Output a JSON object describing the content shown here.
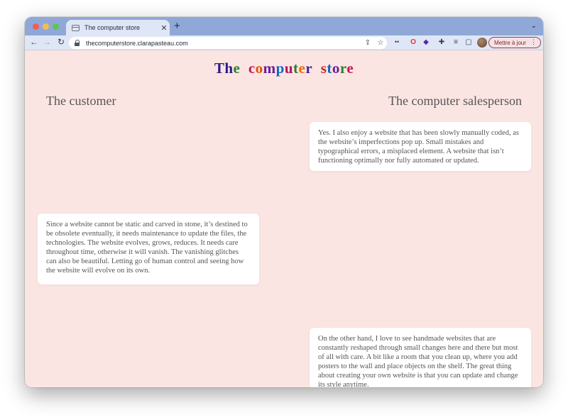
{
  "browser": {
    "tab_title": "The computer store",
    "url": "thecomputerstore.clarapasteau.com",
    "update_button": "Mettre à jour",
    "icons": [
      "back-icon",
      "forward-icon",
      "reload-icon",
      "lock-icon",
      "share-icon",
      "star-icon",
      "opera-icon",
      "extensions-icon",
      "reading-list-icon",
      "side-panel-icon",
      "avatar",
      "menu-icon"
    ]
  },
  "page": {
    "title_words": [
      {
        "text": "The",
        "color": "#1a1a7a"
      },
      {
        "text": "computer",
        "color": "#c02a9a"
      },
      {
        "text": "store",
        "color": "#6a2a9a"
      }
    ],
    "title_letters": [
      {
        "ch": "T",
        "color": "#2a1a8a"
      },
      {
        "ch": "h",
        "color": "#2a1a8a"
      },
      {
        "ch": "e",
        "color": "#2e7d32"
      },
      {
        "ch": " ",
        "color": "#000"
      },
      {
        "ch": "c",
        "color": "#c2185b"
      },
      {
        "ch": "o",
        "color": "#e65100"
      },
      {
        "ch": "m",
        "color": "#6a1b9a"
      },
      {
        "ch": "p",
        "color": "#1565c0"
      },
      {
        "ch": "u",
        "color": "#ad1457"
      },
      {
        "ch": "t",
        "color": "#2e7d32"
      },
      {
        "ch": "e",
        "color": "#ef6c00"
      },
      {
        "ch": "r",
        "color": "#4527a0"
      },
      {
        "ch": " ",
        "color": "#000"
      },
      {
        "ch": "s",
        "color": "#c62828"
      },
      {
        "ch": "t",
        "color": "#1565c0"
      },
      {
        "ch": "o",
        "color": "#6a1b9a"
      },
      {
        "ch": "r",
        "color": "#2e7d32"
      },
      {
        "ch": "e",
        "color": "#c2185b"
      }
    ],
    "column_left": "The customer",
    "column_right": "The computer salesperson",
    "cards": [
      {
        "text": "Yes. I also enjoy a website that has been slowly manually coded, as the website’s imperfections pop up. Small mistakes and typographical errors, a misplaced element. A website that isn’t functioning optimally nor fully automated or updated."
      },
      {
        "text": "Since a website cannot be static and carved in stone, it’s destined to be obsolete eventually, it needs maintenance to update the files, the technologies. The website evolves, grows, reduces. It needs care throughout time, otherwise it will vanish. The vanishing glitches can also be beautiful. Letting go of human control and seeing how the website will evolve on its own."
      },
      {
        "text": "On the other hand, I love to see handmade websites that are constantly reshaped through small changes here and there but most of all with care. A bit like a room that you clean up, where you add posters to the wall and place objects on the shelf. The great thing about creating your own website is that you can update and change its style anytime."
      }
    ]
  }
}
